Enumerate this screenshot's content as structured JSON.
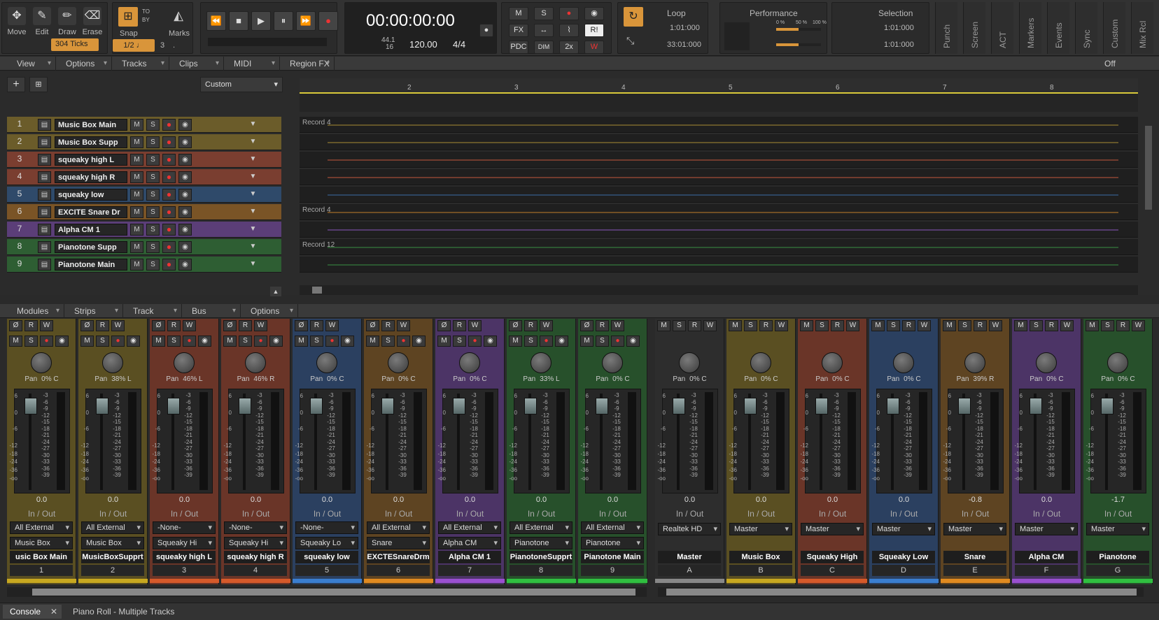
{
  "tools": [
    {
      "label": "Move",
      "icon": "move-icon"
    },
    {
      "label": "Edit",
      "icon": "edit-icon"
    },
    {
      "label": "Draw",
      "icon": "draw-icon"
    },
    {
      "label": "Erase",
      "icon": "erase-icon"
    }
  ],
  "snap": {
    "label": "Snap",
    "ticks": "304 Ticks",
    "value": "1/2",
    "triplet": "3",
    "marks": "Marks",
    "to": "TO",
    "by": "BY"
  },
  "transport": {
    "time": "00:00:00:00",
    "rate": "44.1",
    "bits": "16",
    "tempo": "120.00",
    "meter": "4/4"
  },
  "mixbtns": {
    "m": "M",
    "s": "S",
    "fx": "FX",
    "pdc": "PDC",
    "dim": "DIM",
    "x2": "2x",
    "ri": "R!"
  },
  "loop": {
    "title": "Loop",
    "start": "1:01:000",
    "end": "33:01:000"
  },
  "performance": {
    "title": "Performance",
    "p0": "0 %",
    "p50": "50 %",
    "p100": "100 %"
  },
  "selection": {
    "title": "Selection",
    "start": "1:01:000",
    "end": "1:01:000"
  },
  "vtabs": [
    "Punch",
    "Screen",
    "ACT",
    "Markers",
    "Events",
    "Sync",
    "Custom",
    "Mix Rcl"
  ],
  "menus": [
    "View",
    "Options",
    "Tracks",
    "Clips",
    "MIDI",
    "Region FX"
  ],
  "snap_off": "Off",
  "track_preset": "Custom",
  "ruler": [
    "2",
    "3",
    "4",
    "5",
    "6",
    "7",
    "8"
  ],
  "tracks": [
    {
      "num": "1",
      "name": "Music Box Main",
      "color": "#6b5c2a",
      "clip": "Record 4"
    },
    {
      "num": "2",
      "name": "Music Box Supp",
      "color": "#6b5c2a",
      "clip": ""
    },
    {
      "num": "3",
      "name": "squeaky high L",
      "color": "#7a3e30",
      "clip": ""
    },
    {
      "num": "4",
      "name": "squeaky high R",
      "color": "#7a3e30",
      "clip": ""
    },
    {
      "num": "5",
      "name": "squeaky low",
      "color": "#2f4a6a",
      "clip": ""
    },
    {
      "num": "6",
      "name": "EXCITE Snare Dr",
      "color": "#7a5426",
      "clip": "Record 4"
    },
    {
      "num": "7",
      "name": "Alpha CM 1",
      "color": "#5b3e78",
      "clip": ""
    },
    {
      "num": "8",
      "name": "Pianotone Supp",
      "color": "#2e5e33",
      "clip": "Record 12"
    },
    {
      "num": "9",
      "name": "Pianotone Main",
      "color": "#2e5e33",
      "clip": ""
    }
  ],
  "console_menus": [
    "Modules",
    "Strips",
    "Track",
    "Bus",
    "Options"
  ],
  "fader_scale": [
    "-3",
    "-6",
    "-9",
    "-12",
    "-15",
    "-18",
    "-21",
    "-24",
    "-27",
    "-30",
    "-33",
    "-36",
    "-39"
  ],
  "fader_left": [
    "6",
    "",
    "0",
    "",
    "-6",
    "",
    "-12",
    "-18",
    "-24",
    "-36",
    "-oo"
  ],
  "io_label": "In / Out",
  "strips": [
    {
      "name": "usic Box Main",
      "num": "1",
      "pan": "Pan",
      "panv": "0% C",
      "vol": "0.0",
      "in": "All External",
      "out": "Music Box",
      "color": "#5a4f22",
      "bar": "#c8a820"
    },
    {
      "name": "MusicBoxSupprt",
      "num": "2",
      "pan": "Pan",
      "panv": "38% L",
      "vol": "0.0",
      "in": "All External",
      "out": "Music Box",
      "color": "#5a4f22",
      "bar": "#c8a820"
    },
    {
      "name": "squeaky high L",
      "num": "3",
      "pan": "Pan",
      "panv": "46% L",
      "vol": "0.0",
      "in": "-None-",
      "out": "Squeaky Hi",
      "color": "#6a3528",
      "bar": "#d65a2a"
    },
    {
      "name": "squeaky high R",
      "num": "4",
      "pan": "Pan",
      "panv": "46% R",
      "vol": "0.0",
      "in": "-None-",
      "out": "Squeaky Hi",
      "color": "#6a3528",
      "bar": "#d65a2a"
    },
    {
      "name": "squeaky low",
      "num": "5",
      "pan": "Pan",
      "panv": "0% C",
      "vol": "0.0",
      "in": "-None-",
      "out": "Squeaky Lo",
      "color": "#2b4060",
      "bar": "#3a7ed0"
    },
    {
      "name": "EXCTESnareDrm",
      "num": "6",
      "pan": "Pan",
      "panv": "0% C",
      "vol": "0.0",
      "in": "All External",
      "out": "Snare",
      "color": "#5e4422",
      "bar": "#e08a20"
    },
    {
      "name": "Alpha CM 1",
      "num": "7",
      "pan": "Pan",
      "panv": "0% C",
      "vol": "0.0",
      "in": "All External",
      "out": "Alpha CM",
      "color": "#4c3466",
      "bar": "#9a50d0"
    },
    {
      "name": "PianotoneSupprt",
      "num": "8",
      "pan": "Pan",
      "panv": "33% L",
      "vol": "0.0",
      "in": "All External",
      "out": "Pianotone",
      "color": "#27502b",
      "bar": "#30c040"
    },
    {
      "name": "Pianotone Main",
      "num": "9",
      "pan": "Pan",
      "panv": "0% C",
      "vol": "0.0",
      "in": "All External",
      "out": "Pianotone",
      "color": "#27502b",
      "bar": "#30c040"
    }
  ],
  "buses": [
    {
      "name": "Master",
      "num": "A",
      "pan": "Pan",
      "panv": "0% C",
      "vol": "0.0",
      "out": "Realtek HD",
      "color": "#2d2d2d",
      "bar": "#888"
    },
    {
      "name": "Music Box",
      "num": "B",
      "pan": "Pan",
      "panv": "0% C",
      "vol": "0.0",
      "out": "Master",
      "color": "#5a4f22",
      "bar": "#c8a820"
    },
    {
      "name": "Squeaky High",
      "num": "C",
      "pan": "Pan",
      "panv": "0% C",
      "vol": "0.0",
      "out": "Master",
      "color": "#6a3528",
      "bar": "#d65a2a"
    },
    {
      "name": "Squeaky Low",
      "num": "D",
      "pan": "Pan",
      "panv": "0% C",
      "vol": "0.0",
      "out": "Master",
      "color": "#2b4060",
      "bar": "#3a7ed0"
    },
    {
      "name": "Snare",
      "num": "E",
      "pan": "Pan",
      "panv": "39% R",
      "vol": "-0.8",
      "out": "Master",
      "color": "#5e4422",
      "bar": "#e08a20"
    },
    {
      "name": "Alpha CM",
      "num": "F",
      "pan": "Pan",
      "panv": "0% C",
      "vol": "0.0",
      "out": "Master",
      "color": "#4c3466",
      "bar": "#9a50d0"
    },
    {
      "name": "Pianotone",
      "num": "G",
      "pan": "Pan",
      "panv": "0% C",
      "vol": "-1.7",
      "out": "Master",
      "color": "#27502b",
      "bar": "#30c040"
    }
  ],
  "bottom_tabs": [
    {
      "label": "Console"
    },
    {
      "label": "Piano Roll - Multiple Tracks"
    }
  ]
}
